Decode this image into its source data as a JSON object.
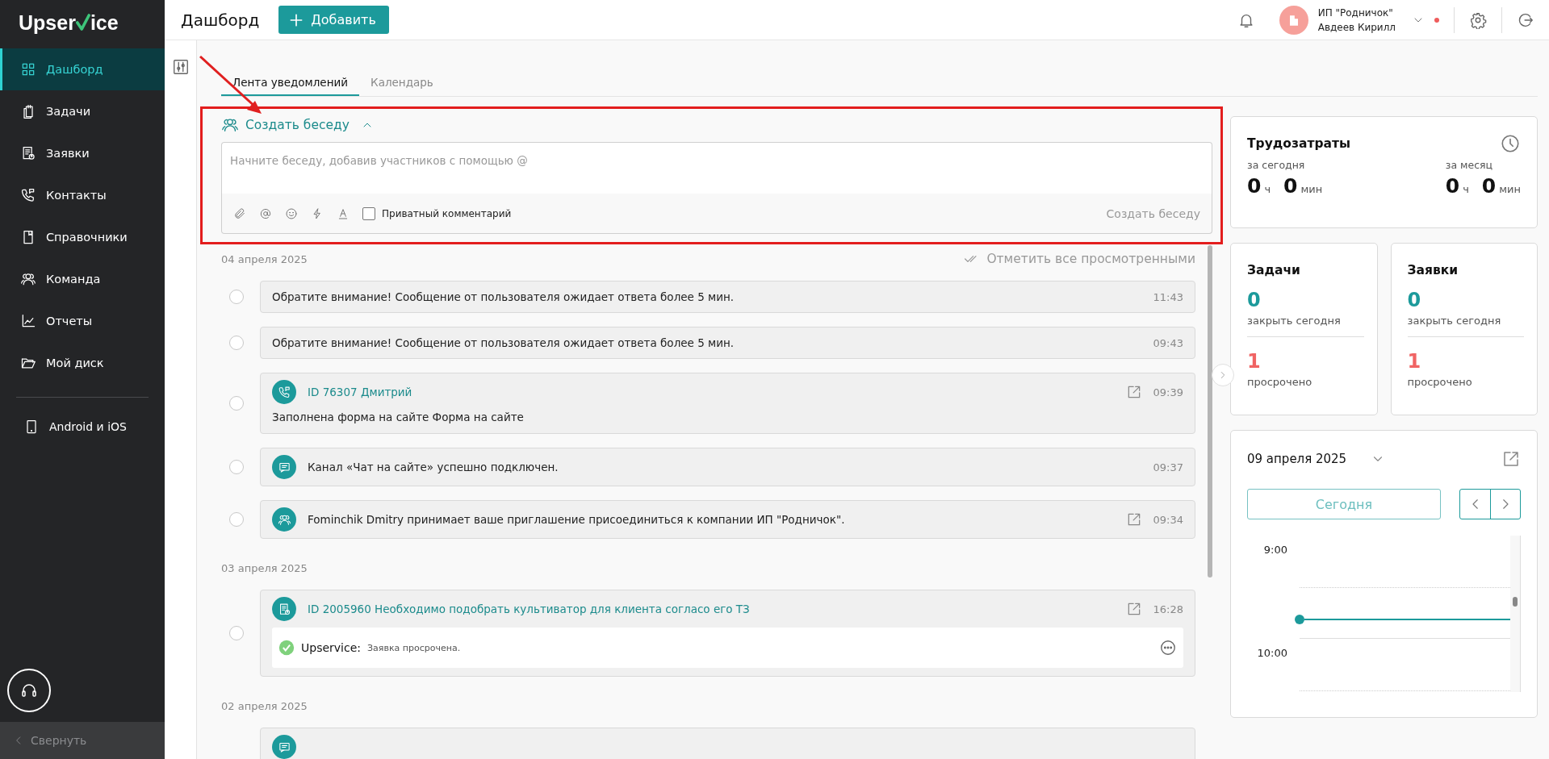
{
  "sidebar": {
    "logo_left": "Upser",
    "logo_right": "ice",
    "items": [
      {
        "label": "Дашборд",
        "selected": true
      },
      {
        "label": "Задачи",
        "selected": false
      },
      {
        "label": "Заявки",
        "selected": false
      },
      {
        "label": "Контакты",
        "selected": false
      },
      {
        "label": "Справочники",
        "selected": false
      },
      {
        "label": "Команда",
        "selected": false
      },
      {
        "label": "Отчеты",
        "selected": false
      },
      {
        "label": "Мой диск",
        "selected": false
      }
    ],
    "apps_label": "Android и iOS",
    "collapse_label": "Свернуть"
  },
  "header": {
    "title": "Дашборд",
    "add_button": "Добавить",
    "org": "ИП \"Родничок\"",
    "user": "Авдеев Кирилл"
  },
  "tabs": [
    {
      "label": "Лента уведомлений",
      "selected": true
    },
    {
      "label": "Календарь",
      "selected": false
    }
  ],
  "composer": {
    "title": "Создать беседу",
    "expanded": true,
    "placeholder": "Начните беседу, добавив участников с помощью @",
    "private_label": "Приватный комментарий",
    "private_checked": false,
    "submit": "Создать беседу"
  },
  "feed": {
    "mark_all": "Отметить все просмотренными",
    "groups": [
      {
        "date": "04 апреля 2025",
        "items": [
          {
            "kind": "alert",
            "text": "Обратите внимание! Сообщение от пользователя ожидает ответа более 5 мин.",
            "time": "11:43",
            "checked": false,
            "open": false
          },
          {
            "kind": "alert",
            "text": "Обратите внимание! Сообщение от пользователя ожидает ответа более 5 мин.",
            "time": "09:43",
            "checked": false,
            "open": false
          },
          {
            "kind": "contact",
            "title": "ID 76307 Дмитрий",
            "body": "Заполнена форма на сайте Форма на сайте",
            "time": "09:39",
            "checked": false,
            "open": true
          },
          {
            "kind": "channel",
            "text": "Канал «Чат на сайте» успешно подключен.",
            "time": "09:37",
            "checked": false,
            "open": false
          },
          {
            "kind": "team",
            "text": "Fominchik Dmitry принимает ваше приглашение присоединиться к компании ИП \"Родничок\".",
            "time": "09:34",
            "checked": false,
            "open": true
          }
        ]
      },
      {
        "date": "03 апреля 2025",
        "items": [
          {
            "kind": "request",
            "title": "ID 2005960 Необходимо подобрать культиватор для клиента согласо его ТЗ",
            "time": "16:28",
            "checked": false,
            "open": true,
            "comment": {
              "author": "Upservice:",
              "text": "Заявка просрочена."
            }
          }
        ]
      },
      {
        "date": "02 апреля 2025",
        "items": [
          {
            "kind": "stub"
          }
        ]
      }
    ]
  },
  "labor": {
    "title": "Трудозатраты",
    "periods": [
      {
        "label": "за сегодня",
        "hours": "0",
        "hours_unit": "ч",
        "minutes": "0",
        "minutes_unit": "мин"
      },
      {
        "label": "за месяц",
        "hours": "0",
        "hours_unit": "ч",
        "minutes": "0",
        "minutes_unit": "мин"
      }
    ]
  },
  "counters": [
    {
      "title": "Задачи",
      "due": "0",
      "due_label": "закрыть сегодня",
      "overdue": "1",
      "overdue_label": "просрочено"
    },
    {
      "title": "Заявки",
      "due": "0",
      "due_label": "закрыть сегодня",
      "overdue": "1",
      "overdue_label": "просрочено"
    }
  ],
  "calendar": {
    "date": "09 апреля 2025",
    "today_button": "Сегодня",
    "hours": [
      "9:00",
      "10:00"
    ]
  }
}
